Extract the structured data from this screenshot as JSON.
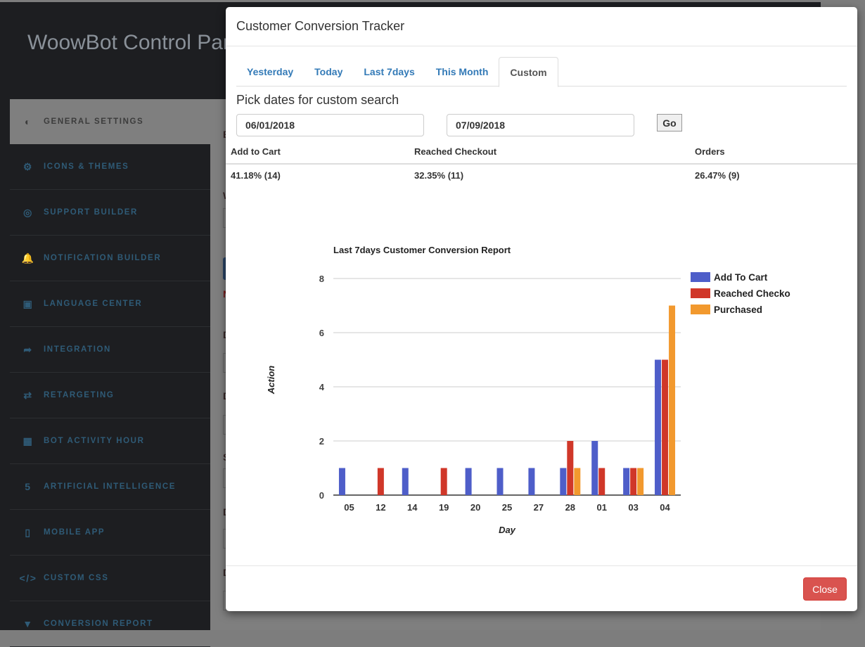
{
  "app": {
    "title": "WoowBot Control Panel",
    "sidebar": [
      {
        "label": "GENERAL SETTINGS",
        "icon": "toggle-icon",
        "glyph": "◐",
        "active": true
      },
      {
        "label": "ICONS & THEMES",
        "icon": "gear-icon",
        "glyph": "⚙"
      },
      {
        "label": "SUPPORT BUILDER",
        "icon": "life-ring-icon",
        "glyph": "◎"
      },
      {
        "label": "NOTIFICATION BUILDER",
        "icon": "bell-icon",
        "glyph": "🔔"
      },
      {
        "label": "LANGUAGE CENTER",
        "icon": "language-icon",
        "glyph": "▣"
      },
      {
        "label": "INTEGRATION",
        "icon": "share-arrow-icon",
        "glyph": "➦"
      },
      {
        "label": "RETARGETING",
        "icon": "retweet-icon",
        "glyph": "⇄"
      },
      {
        "label": "BOT ACTIVITY HOUR",
        "icon": "calendar-icon",
        "glyph": "▦"
      },
      {
        "label": "ARTIFICIAL INTELLIGENCE",
        "icon": "html5-icon",
        "glyph": "5"
      },
      {
        "label": "MOBILE APP",
        "icon": "mobile-icon",
        "glyph": "▯"
      },
      {
        "label": "CUSTOM CSS",
        "icon": "code-icon",
        "glyph": "</>"
      },
      {
        "label": "CONVERSION REPORT",
        "icon": "filter-icon",
        "glyph": "▼"
      }
    ]
  },
  "modal": {
    "title": "Customer Conversion Tracker",
    "tabs": [
      {
        "label": "Yesterday"
      },
      {
        "label": "Today"
      },
      {
        "label": "Last 7days"
      },
      {
        "label": "This Month"
      },
      {
        "label": "Custom",
        "active": true
      }
    ],
    "pick_label": "Pick dates for custom search",
    "start_date": "06/01/2018",
    "end_date": "07/09/2018",
    "go_label": "Go",
    "stats": {
      "headers": [
        "Add to Cart",
        "Reached Checkout",
        "Orders"
      ],
      "values": [
        "41.18% (14)",
        "32.35% (11)",
        "26.47% (9)"
      ]
    },
    "close_label": "Close"
  },
  "chart_data": {
    "type": "bar",
    "title": "Last 7days Customer Conversion Report",
    "xlabel": "Day",
    "ylabel": "Action",
    "ylim": [
      0,
      8
    ],
    "yticks": [
      0,
      2,
      4,
      6,
      8
    ],
    "grid": true,
    "legend": "right",
    "categories": [
      "05",
      "12",
      "14",
      "19",
      "20",
      "25",
      "27",
      "28",
      "01",
      "03",
      "04"
    ],
    "series": [
      {
        "name": "Add To Cart",
        "legend_label": "Add To Cart",
        "color": "#4e5ec9",
        "values": [
          1,
          0,
          1,
          0,
          1,
          1,
          1,
          1,
          2,
          1,
          5
        ]
      },
      {
        "name": "Reached Checkout",
        "legend_label": "Reached Checko",
        "color": "#d03729",
        "values": [
          0,
          1,
          0,
          1,
          0,
          0,
          0,
          2,
          1,
          1,
          5
        ]
      },
      {
        "name": "Purchased",
        "legend_label": "Purchased",
        "color": "#f2992e",
        "values": [
          0,
          0,
          0,
          0,
          0,
          0,
          0,
          1,
          0,
          1,
          7
        ]
      }
    ]
  }
}
